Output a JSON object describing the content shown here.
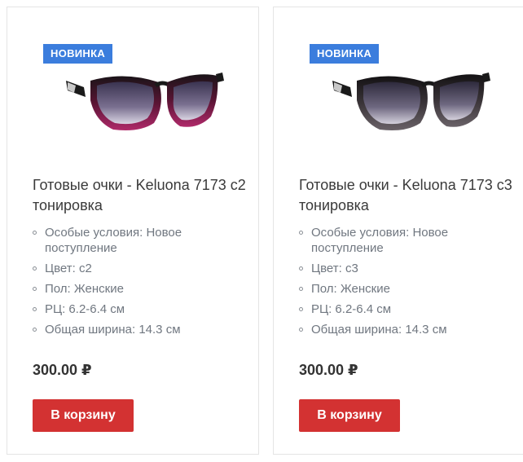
{
  "products": [
    {
      "badge": "НОВИНКА",
      "title": "Готовые очки - Keluona 7173 с2 тонировка",
      "properties": [
        "Особые условия: Новое поступление",
        "Цвет: с2",
        "Пол: Женские",
        "РЦ: 6.2-6.4 см",
        "Общая ширина: 14.3 см"
      ],
      "price": "300.00 ₽",
      "button": "В корзину",
      "frame_color": "#8a1a4a",
      "lens_color": "#5a4f7a"
    },
    {
      "badge": "НОВИНКА",
      "title": "Готовые очки - Keluona 7173 с3 тонировка",
      "properties": [
        "Особые условия: Новое поступление",
        "Цвет: с3",
        "Пол: Женские",
        "РЦ: 6.2-6.4 см",
        "Общая ширина: 14.3 см"
      ],
      "price": "300.00 ₽",
      "button": "В корзину",
      "frame_color": "#3a3438",
      "lens_color": "#55506a"
    }
  ],
  "colors": {
    "badge_bg": "#3b7ddd",
    "button_bg": "#d33232",
    "text_main": "#3a3a3a",
    "text_muted": "#707780"
  }
}
